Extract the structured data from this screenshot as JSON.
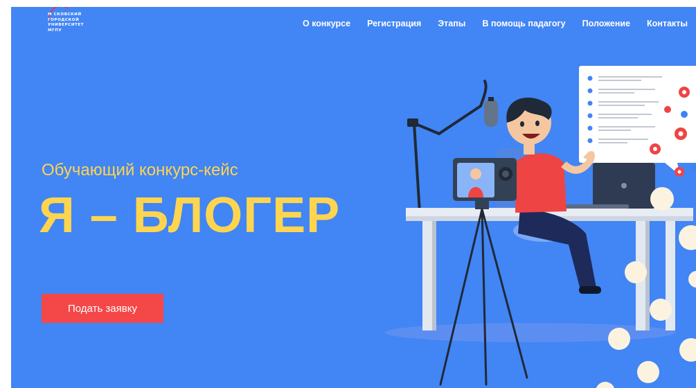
{
  "logo": {
    "lines": [
      "М СКОВСКИЙ",
      "ГОРОДСКОЙ",
      "УНИВЕРСИТЕТ",
      "МГПУ"
    ],
    "accent": "#e53935"
  },
  "nav": {
    "items": [
      {
        "label": "О конкурсе"
      },
      {
        "label": "Регистрация"
      },
      {
        "label": "Этапы"
      },
      {
        "label": "В помощь падагогу"
      },
      {
        "label": "Положение"
      },
      {
        "label": "Контакты"
      }
    ]
  },
  "hero": {
    "subtitle": "Обучающий конкурс-кейс",
    "title": "Я – БЛОГЕР",
    "cta_label": "Подать заявку"
  },
  "colors": {
    "background": "#4285f4",
    "title": "#ffd54f",
    "button": "#f44747",
    "dots": "#fbf3df"
  }
}
